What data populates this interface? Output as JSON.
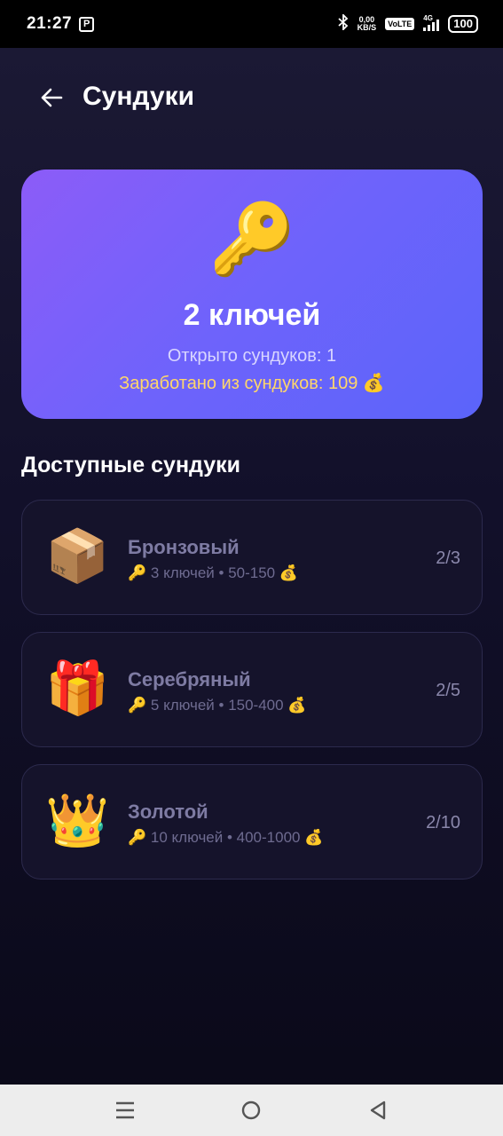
{
  "status_bar": {
    "time": "21:27",
    "app_icon": "P",
    "net_speed_value": "0,00",
    "net_speed_unit": "KB/S",
    "volte": "VoLTE",
    "network": "4G",
    "battery": "100"
  },
  "header": {
    "back_icon": "arrow-left-icon",
    "title": "Сундуки"
  },
  "hero": {
    "icon": "🔑",
    "keys_count": "2 ключей",
    "opened": "Открыто сундуков: 1",
    "earned": "Заработано из сундуков: 109 💰"
  },
  "section": {
    "title": "Доступные сундуки"
  },
  "chests": [
    {
      "emoji": "📦",
      "name": "Бронзовый",
      "meta": "🔑 3 ключей • 50-150 💰",
      "progress": "2/3"
    },
    {
      "emoji": "🎁",
      "name": "Серебряный",
      "meta": "🔑 5 ключей • 150-400 💰",
      "progress": "2/5"
    },
    {
      "emoji": "👑",
      "name": "Золотой",
      "meta": "🔑 10 ключей • 400-1000 💰",
      "progress": "2/10"
    }
  ],
  "nav": {
    "menu_icon": "menu-icon",
    "home_icon": "home-circle-icon",
    "back_icon": "back-triangle-icon"
  },
  "colors": {
    "hero_gradient_start": "#8c5cf8",
    "hero_gradient_end": "#5b64fa",
    "earned_text": "#ffd76a",
    "card_background": "#15132b"
  }
}
